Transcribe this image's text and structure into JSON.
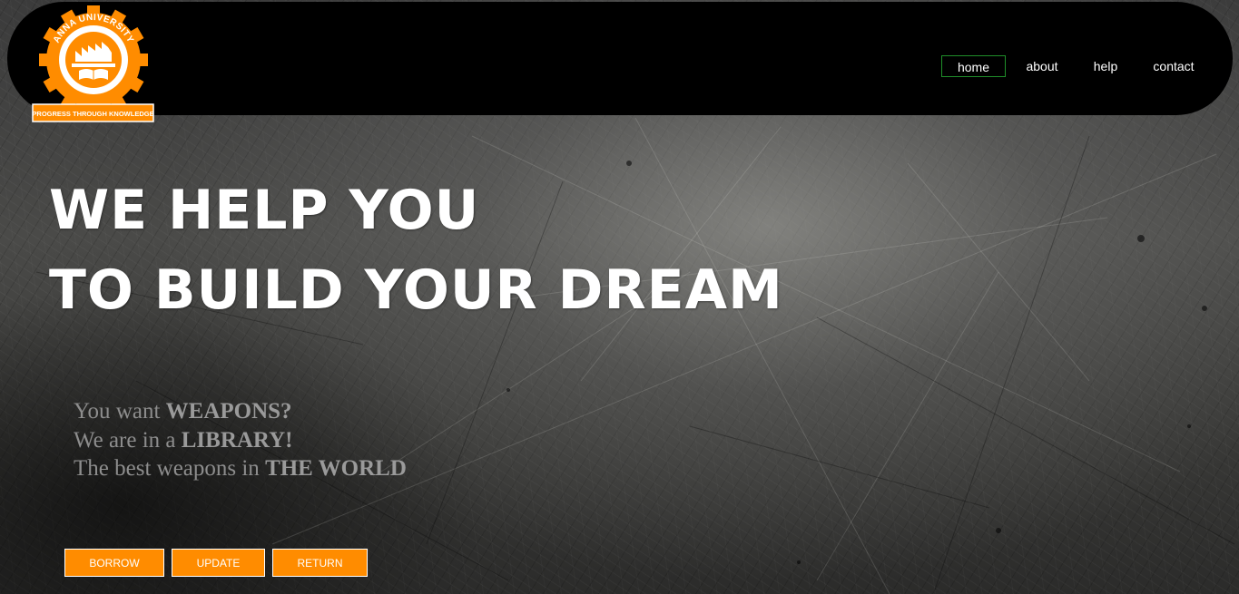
{
  "logo": {
    "university_text": "ANNA UNIVERSITY",
    "motto": "PROGRESS THROUGH KNOWLEDGE",
    "accent_color": "#ff8c00"
  },
  "nav": {
    "items": [
      {
        "label": "home",
        "active": true
      },
      {
        "label": "about",
        "active": false
      },
      {
        "label": "help",
        "active": false
      },
      {
        "label": "contact",
        "active": false
      }
    ],
    "active_border_color": "#1f8f2a"
  },
  "hero": {
    "line1": "WE HELP YOU",
    "line2": "TO BUILD YOUR DREAM"
  },
  "tagline": {
    "line1_prefix": "You want ",
    "line1_bold": "WEAPONS?",
    "line2_prefix": "We are in a ",
    "line2_bold": "LIBRARY!",
    "line3_prefix": "The best weapons in ",
    "line3_bold": "THE WORLD"
  },
  "buttons": {
    "borrow": "BORROW",
    "update": "UPDATE",
    "return": "RETURN",
    "color": "#ff8c00"
  }
}
